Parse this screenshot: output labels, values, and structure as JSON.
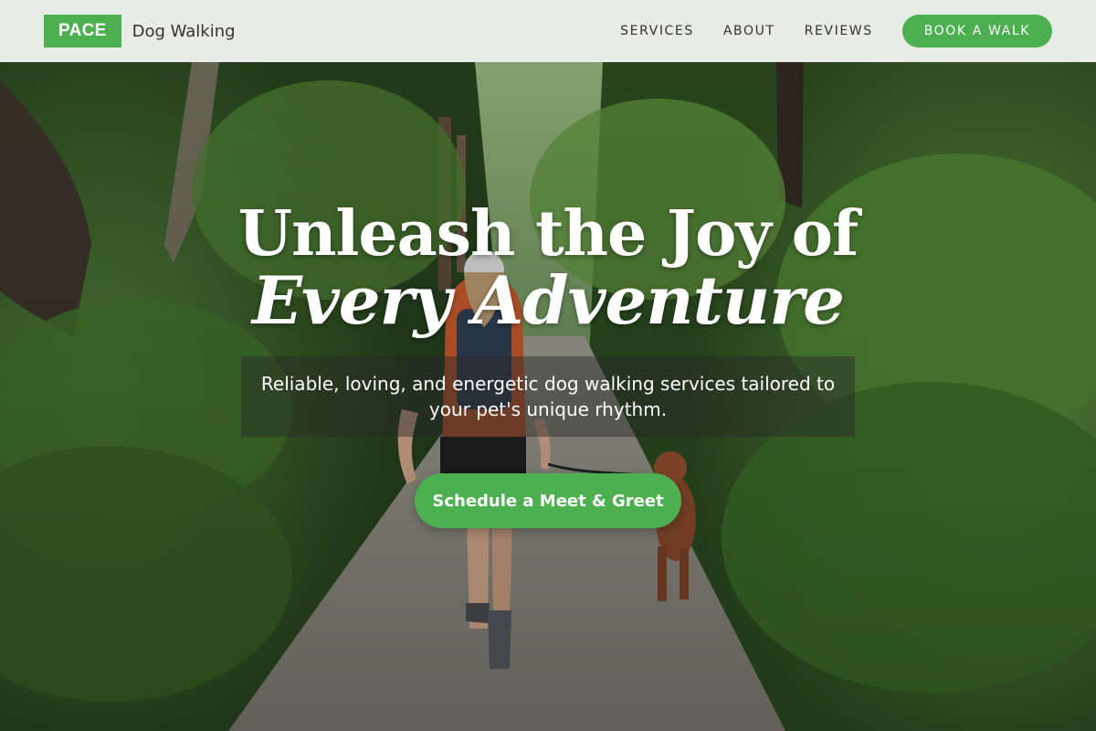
{
  "brand": {
    "logo": "PACE",
    "subtitle": "Dog Walking"
  },
  "nav": {
    "items": [
      {
        "label": "SERVICES"
      },
      {
        "label": "ABOUT"
      },
      {
        "label": "REVIEWS"
      }
    ],
    "cta_label": "BOOK A WALK"
  },
  "hero": {
    "headline_line1": "Unleash the Joy of",
    "headline_line2": "Every Adventure",
    "subtitle": "Reliable, loving, and energetic dog walking services tailored to your pet's unique rhythm.",
    "cta_label": "Schedule a Meet & Greet"
  },
  "colors": {
    "accent": "#4caf50",
    "header_bg": "#f6f7f5"
  }
}
